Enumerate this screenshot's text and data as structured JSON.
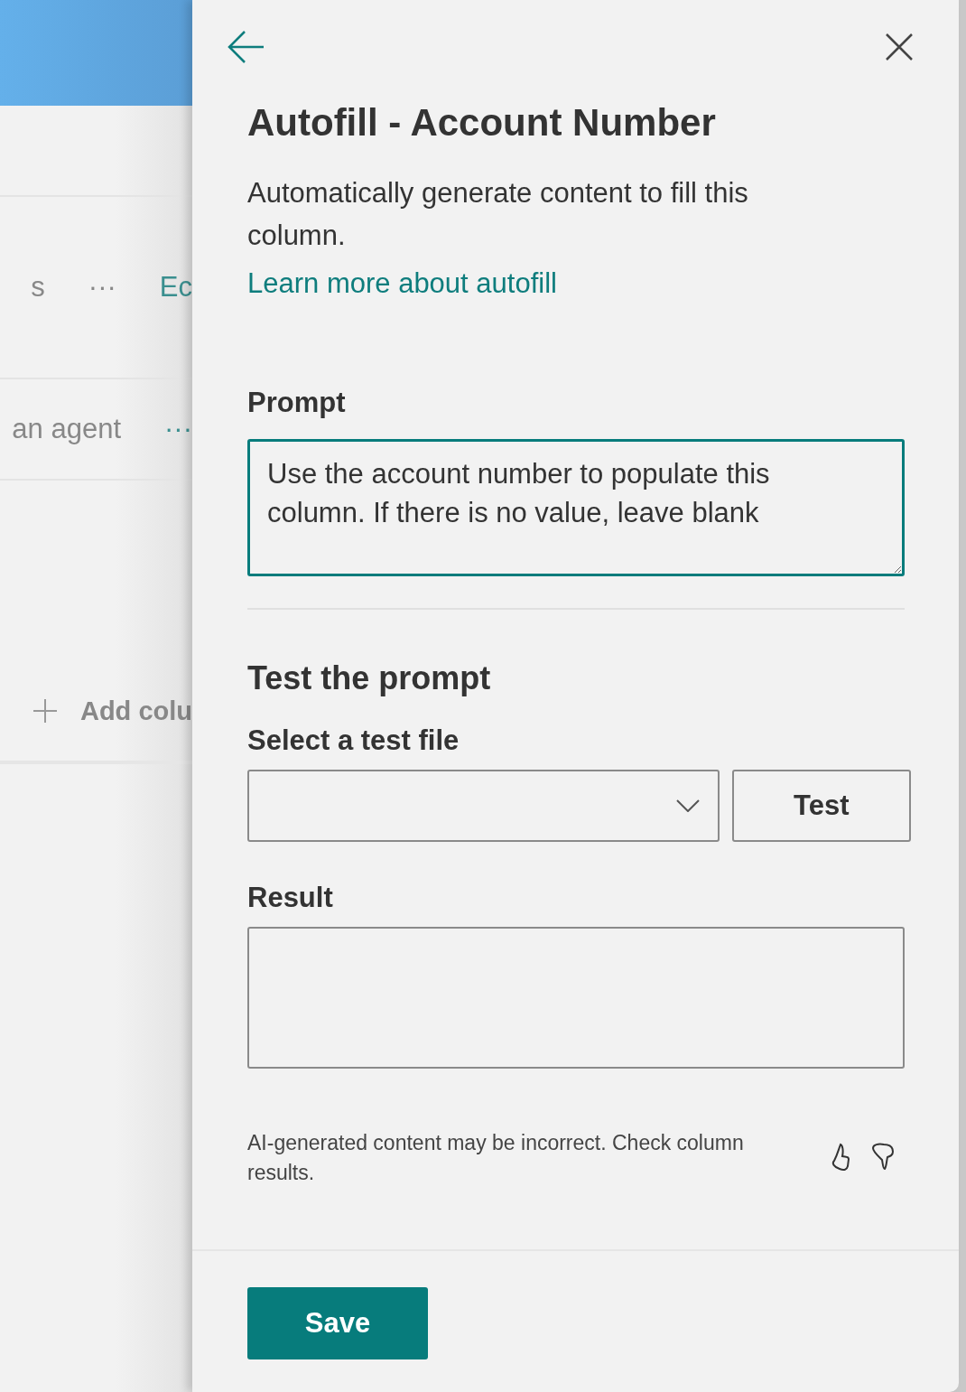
{
  "background_page": {
    "items": [
      {
        "name": "s",
        "menu": "···",
        "action": "Ec"
      },
      {
        "name": "an agent",
        "menu": "···"
      }
    ],
    "add_column": {
      "label": "Add colu"
    }
  },
  "panel": {
    "title": "Autofill - Account Number",
    "description": "Automatically generate content to fill this column.",
    "link": "Learn more about autofill",
    "prompt": {
      "label": "Prompt",
      "value": "Use the account number to populate this column. If there is no value, leave blank"
    },
    "test_section": {
      "heading": "Test the prompt",
      "file_label": "Select a test file",
      "test_button": "Test",
      "result_label": "Result"
    },
    "disclaimer": "AI-generated content may be incorrect. Check column results.",
    "save_button": "Save"
  }
}
